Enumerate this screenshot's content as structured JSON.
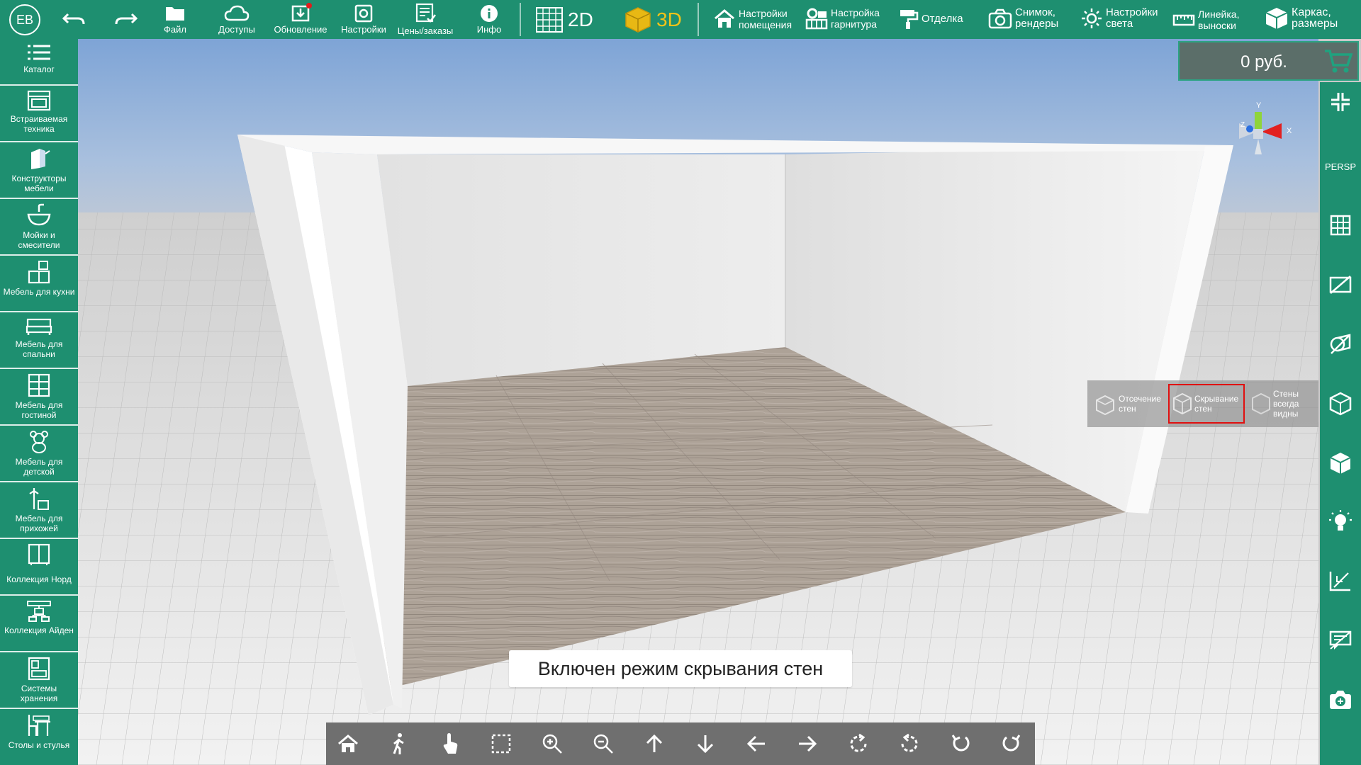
{
  "user": {
    "initials": "ЕВ"
  },
  "toolbar": {
    "undo": "undo",
    "redo": "redo",
    "file": "Файл",
    "access": "Доступы",
    "update": "Обновление",
    "settings": "Настройки",
    "prices": "Цены/заказы",
    "info": "Инфо",
    "mode2d": "2D",
    "mode3d": "3D",
    "room_settings_l1": "Настройки",
    "room_settings_l2": "помещения",
    "headset_l1": "Настройка",
    "headset_l2": "гарнитура",
    "finish": "Отделка",
    "snapshot_l1": "Снимок,",
    "snapshot_l2": "рендеры",
    "light_l1": "Настройки",
    "light_l2": "света",
    "ruler_l1": "Линейка,",
    "ruler_l2": "выноски",
    "frame_l1": "Каркас,",
    "frame_l2": "размеры"
  },
  "sidebar": {
    "items": [
      {
        "label": "Каталог",
        "icon": "list-icon"
      },
      {
        "label": "Встраиваемая техника",
        "icon": "oven-icon"
      },
      {
        "label": "Конструкторы мебели",
        "icon": "cabinet-builder-icon"
      },
      {
        "label": "Мойки и смесители",
        "icon": "sink-icon"
      },
      {
        "label": "Мебель для кухни",
        "icon": "kitchen-icon"
      },
      {
        "label": "Мебель для спальни",
        "icon": "bed-icon"
      },
      {
        "label": "Мебель для гостиной",
        "icon": "shelf-icon"
      },
      {
        "label": "Мебель для детской",
        "icon": "teddy-icon"
      },
      {
        "label": "Мебель для прихожей",
        "icon": "hanger-icon"
      },
      {
        "label": "Коллекция Норд",
        "icon": "wardrobe-icon"
      },
      {
        "label": "Коллекция Айден",
        "icon": "tree-icon"
      },
      {
        "label": "Системы хранения",
        "icon": "storage-icon"
      },
      {
        "label": "Столы и стулья",
        "icon": "table-chair-icon"
      }
    ]
  },
  "price": {
    "value": "0 руб."
  },
  "rightbar": {
    "persp": "PERSP"
  },
  "wall_modes": [
    {
      "label": "Отсечение стен",
      "selected": false
    },
    {
      "label": "Скрывание стен",
      "selected": true
    },
    {
      "label": "Стены всегда видны",
      "selected": false
    }
  ],
  "toast": {
    "message": "Включен режим скрывания стен"
  },
  "gizmo": {
    "y": "Y",
    "x": "X",
    "z": "Z"
  },
  "colors": {
    "primary": "#1e8f70",
    "accent3d": "#f2c318",
    "selection": "#e01010",
    "price_bg": "#5b6e69"
  }
}
